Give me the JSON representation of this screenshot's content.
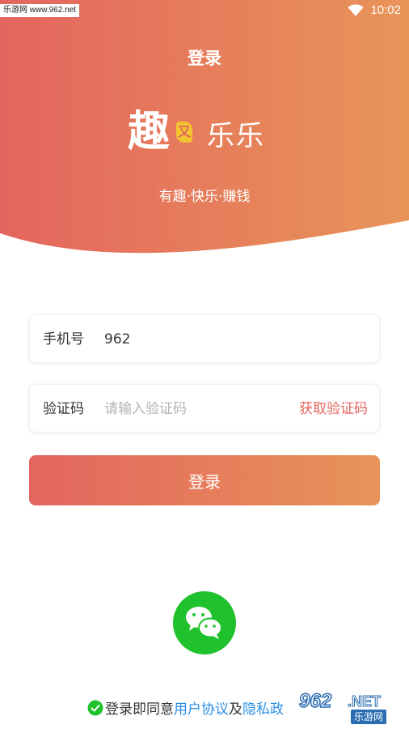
{
  "status_bar": {
    "watermark": "乐游网 www.962.net",
    "time": "10:02"
  },
  "header": {
    "title": "登录",
    "logo_main": "趣",
    "logo_accent": "又",
    "logo_sub": "乐乐",
    "tagline": "有趣·快乐·赚钱"
  },
  "form": {
    "phone_label": "手机号",
    "phone_value": "962",
    "code_label": "验证码",
    "code_placeholder": "请输入验证码",
    "get_code_label": "获取验证码",
    "login_label": "登录"
  },
  "social": {
    "wechat_icon": "wechat-icon"
  },
  "agreement": {
    "prefix": "登录即同意",
    "user_agreement": "用户协议",
    "conjunction": "及",
    "privacy_policy": "隐私政"
  },
  "watermark_bottom": {
    "brand": "962",
    "tld": ".NET",
    "cn": "乐游网"
  },
  "colors": {
    "gradient_start": "#e4655f",
    "gradient_end": "#e79459",
    "accent_red": "#e4655f",
    "link_blue": "#2b8fe6",
    "wechat_green": "#1fc22d"
  }
}
